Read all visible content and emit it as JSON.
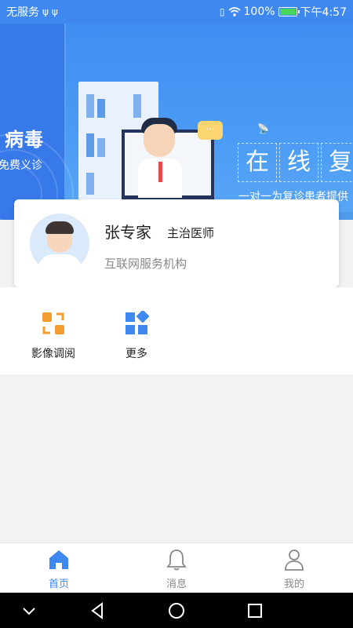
{
  "status_bar": {
    "carrier": "无服务",
    "battery_pct": "100%",
    "time": "下午4:57"
  },
  "banner": {
    "left_title": "病毒",
    "left_subtitle": "免费义诊",
    "clinic_chars": [
      "在",
      "线",
      "复"
    ],
    "tagline": "一对一为复诊患者提供",
    "chat_text": "···"
  },
  "doctor_card": {
    "name": "张专家",
    "title": "主治医师",
    "organization": "互联网服务机构"
  },
  "quick_actions": [
    {
      "label": "影像调阅",
      "icon": "image-review-icon"
    },
    {
      "label": "更多",
      "icon": "more-grid-icon"
    }
  ],
  "tabs": [
    {
      "label": "首页",
      "icon": "home-icon",
      "active": true
    },
    {
      "label": "消息",
      "icon": "bell-icon",
      "active": false
    },
    {
      "label": "我的",
      "icon": "person-icon",
      "active": false
    }
  ],
  "colors": {
    "primary": "#3f88f0",
    "accent_orange": "#f39c2f",
    "tab_inactive": "#888888"
  }
}
